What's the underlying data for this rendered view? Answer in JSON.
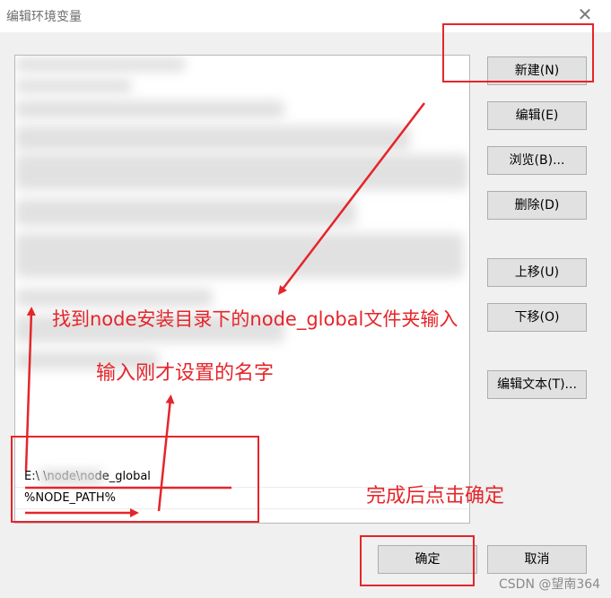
{
  "window": {
    "title": "编辑环境变量",
    "close_glyph": "✕"
  },
  "list": {
    "rows": [
      {
        "text": "E:\\           \\node\\node_global",
        "selected": false
      },
      {
        "text": "%NODE_PATH%",
        "selected": false
      }
    ]
  },
  "buttons": {
    "new": "新建(N)",
    "edit": "编辑(E)",
    "browse": "浏览(B)...",
    "delete": "删除(D)",
    "move_up": "上移(U)",
    "move_down": "下移(O)",
    "edit_text": "编辑文本(T)...",
    "ok": "确定",
    "cancel": "取消"
  },
  "annotations": {
    "find_folder": "找到node安装目录下的node_global文件夹输入",
    "enter_name": "输入刚才设置的名字",
    "click_ok": "完成后点击确定"
  },
  "watermark": "CSDN @望南364",
  "colors": {
    "annotation": "#e5252a",
    "button_bg": "#e1e1e1",
    "dialog_bg": "#f0f0f0"
  }
}
